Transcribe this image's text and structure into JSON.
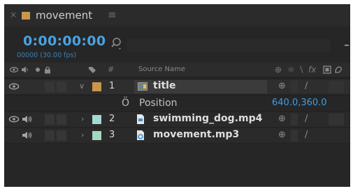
{
  "tab": {
    "title": "movement",
    "close_glyph": "×",
    "menu_glyph": "≡",
    "swatch_color": "#c8964e"
  },
  "timecode": {
    "time": "0:00:00:00",
    "frames": "00000 (30.00 fps)",
    "color": "#4aa3e0"
  },
  "search": {
    "icon": "search-icon",
    "value": ""
  },
  "columns": {
    "number": "#",
    "source_name": "Source Name",
    "switch_glyphs": [
      "⊕",
      "☼",
      "∖",
      "fx"
    ]
  },
  "layers": [
    {
      "number": "1",
      "name": "title",
      "label_color": "#c8964e",
      "icon": "text-layer-icon",
      "expanded": true
    },
    {
      "number": "2",
      "name": "swimming_dog.mp4",
      "label_color": "#a4d8d2",
      "icon": "video-file-icon",
      "expanded": false
    },
    {
      "number": "3",
      "name": "movement.mp3",
      "label_color": "#a4d8c0",
      "icon": "audio-file-icon",
      "expanded": false
    }
  ],
  "property": {
    "name": "Position",
    "value": "640.0,360.0",
    "icon": "stopwatch-icon"
  },
  "glyphs": {
    "chevron_down": "∨",
    "chevron_right": "›",
    "slash": "/",
    "shy": "⊕",
    "stopwatch": "Ö"
  }
}
